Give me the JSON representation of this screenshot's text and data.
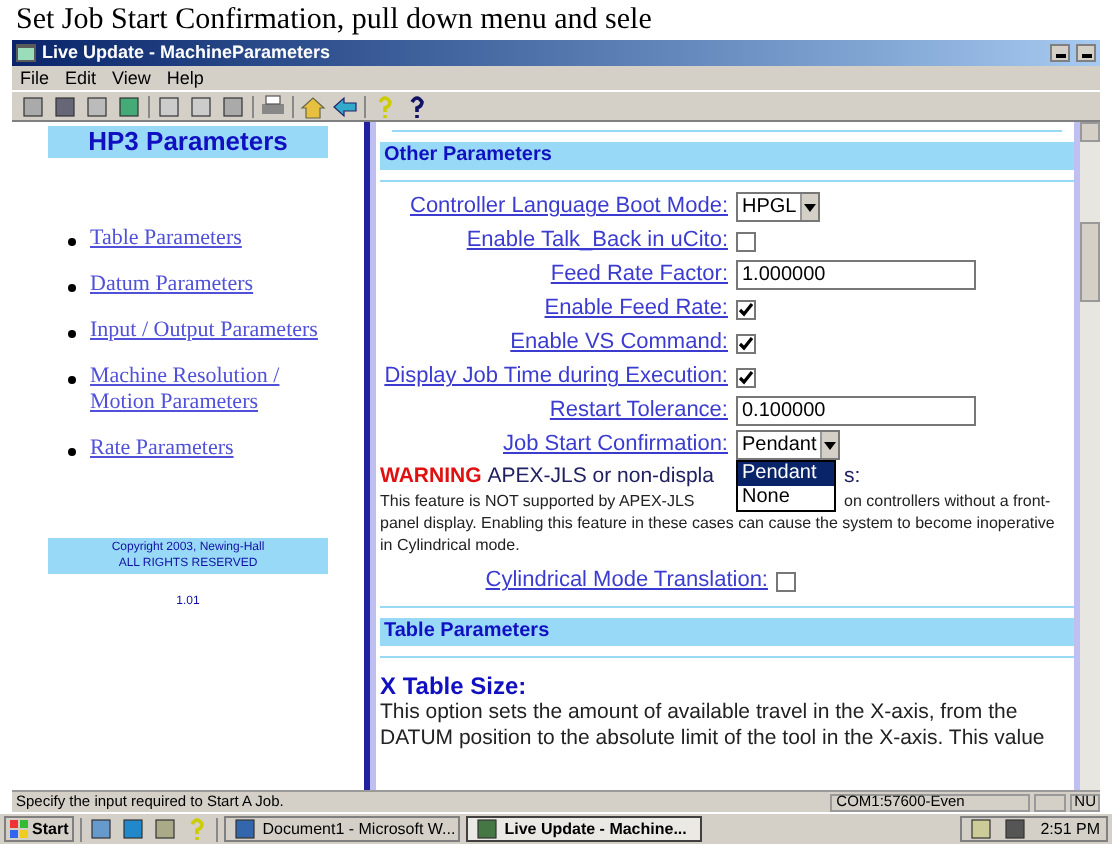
{
  "caption": "Set Job Start Confirmation, pull down menu and sele",
  "window": {
    "title": "Live Update - MachineParameters"
  },
  "menu": [
    "File",
    "Edit",
    "View",
    "Help"
  ],
  "sidebar": {
    "title": "HP3 Parameters",
    "links": [
      "Table Parameters",
      "Datum Parameters",
      "Input / Output Parameters",
      "Machine Resolution / Motion Parameters",
      "Rate Parameters"
    ],
    "copyright": [
      "Copyright 2003, Newing-Hall",
      "ALL RIGHTS RESERVED"
    ],
    "version": "1.01"
  },
  "other_parameters": {
    "title": "Other Parameters",
    "fields": [
      {
        "kind": "select",
        "label": "Controller Language Boot Mode:",
        "value": "HPGL"
      },
      {
        "kind": "checkbox",
        "label": "Enable Talk_Back in uCito:",
        "checked": false
      },
      {
        "kind": "text",
        "label": "Feed Rate Factor:",
        "value": "1.000000"
      },
      {
        "kind": "checkbox",
        "label": "Enable Feed Rate:",
        "checked": true
      },
      {
        "kind": "checkbox",
        "label": "Enable VS Command:",
        "checked": true
      },
      {
        "kind": "checkbox",
        "label": "Display Job Time during Execution:",
        "checked": true
      },
      {
        "kind": "text",
        "label": "Restart Tolerance:",
        "value": "0.100000"
      },
      {
        "kind": "select",
        "label": "Job Start Confirmation:",
        "value": "Pendant",
        "open": true
      }
    ],
    "dropdown_options": [
      {
        "label": "Pendant",
        "selected": true
      },
      {
        "label": "None",
        "selected": false
      }
    ],
    "warning": {
      "label": "WARNING",
      "line_start": "APEX-JLS or non-displa",
      "line_end": "s:",
      "para_start": "This feature is NOT supported by APEX-JLS",
      "para_after": "on controllers without a front-",
      "para_rest": "panel display. Enabling this feature in these cases can cause the system to become inoperative in Cylindrical mode."
    },
    "last_field": {
      "kind": "checkbox",
      "label": "Cylindrical Mode Translation:",
      "checked": false
    }
  },
  "table_parameters": {
    "title": "Table Parameters",
    "subtitle": "X Table Size:",
    "lines": [
      "This option sets the amount of available travel in the X-axis, from the",
      "DATUM position to the absolute limit of the tool in the X-axis. This value"
    ]
  },
  "status_bar": {
    "message": "Specify the input required to Start A Job.",
    "port": "COM1:57600-Even",
    "panel_3": "NU"
  },
  "taskbar": {
    "start": "Start",
    "tasks": [
      {
        "label": "Document1 - Microsoft W...",
        "selected": false
      },
      {
        "label": "Live Update - Machine...",
        "selected": true
      }
    ],
    "clock": "2:51 PM"
  }
}
